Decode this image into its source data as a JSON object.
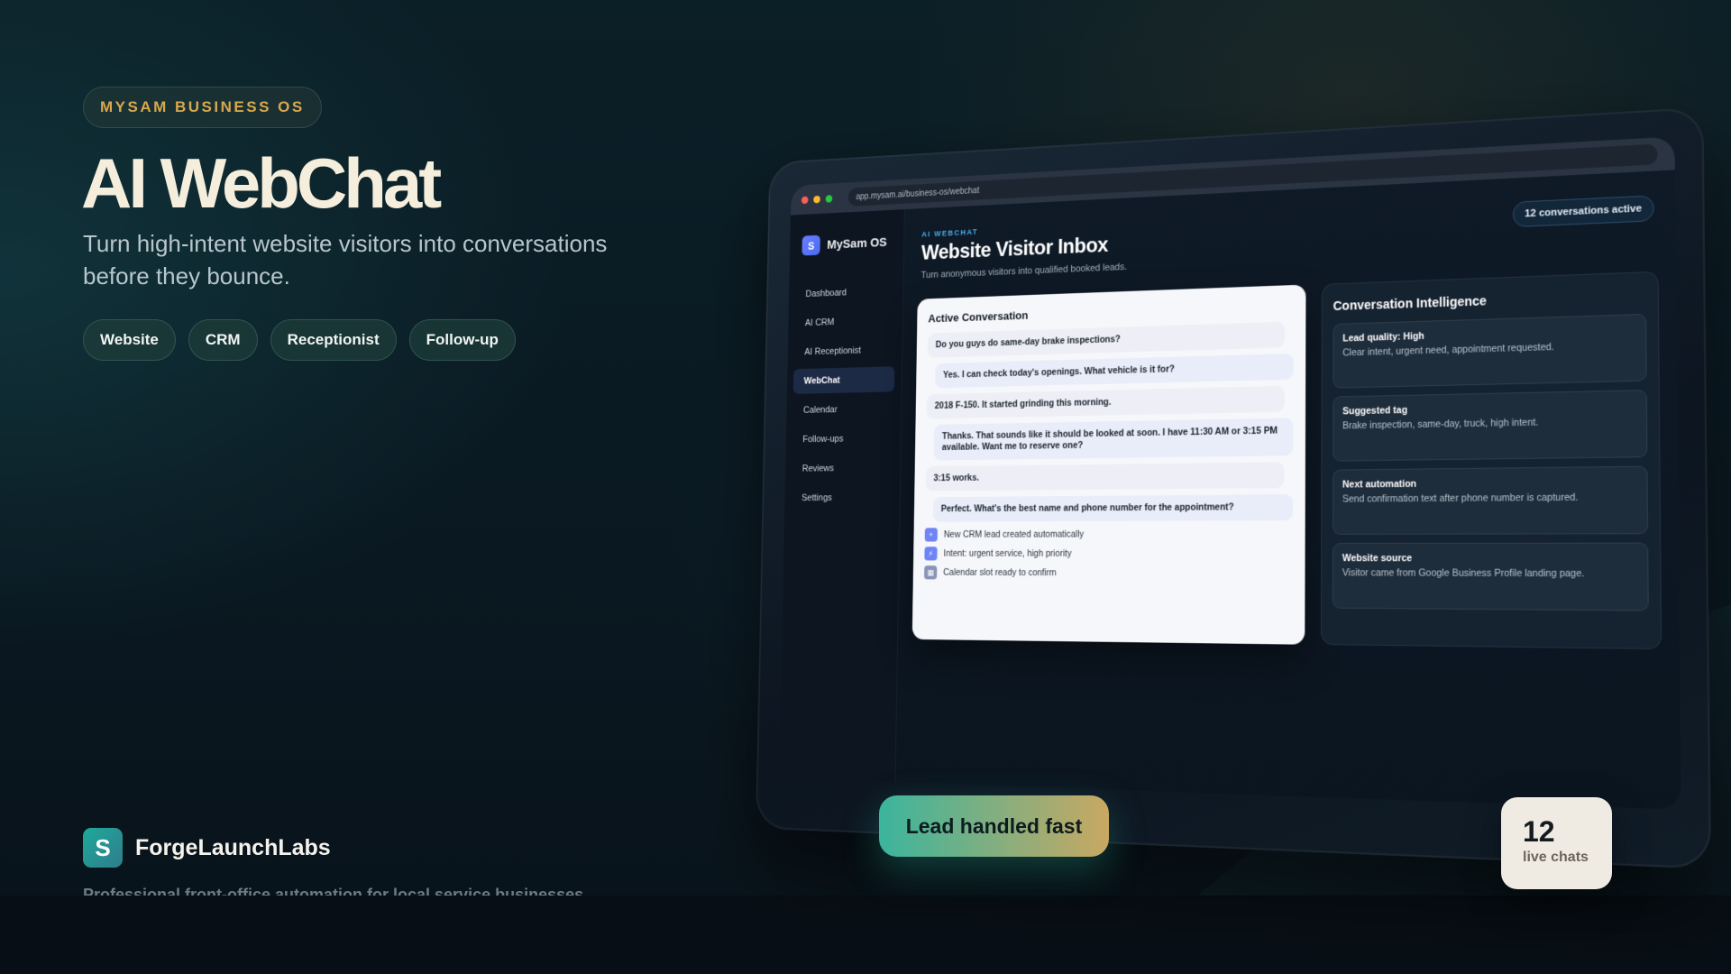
{
  "hero": {
    "badge": "MYSAM BUSINESS OS",
    "title": "AI WebChat",
    "subtitle": "Turn high-intent website visitors into conversations before they bounce.",
    "chips": [
      "Website",
      "CRM",
      "Receptionist",
      "Follow-up"
    ]
  },
  "brand": {
    "logo_letter": "S",
    "name": "ForgeLaunchLabs",
    "tagline": "Professional front-office automation for local service businesses"
  },
  "app": {
    "url": "app.mysam.ai/business-os/webchat",
    "logo_letter": "S",
    "name": "MySam OS",
    "nav": [
      {
        "label": "Dashboard",
        "active": false
      },
      {
        "label": "AI CRM",
        "active": false
      },
      {
        "label": "AI Receptionist",
        "active": false
      },
      {
        "label": "WebChat",
        "active": true
      },
      {
        "label": "Calendar",
        "active": false
      },
      {
        "label": "Follow-ups",
        "active": false
      },
      {
        "label": "Reviews",
        "active": false
      },
      {
        "label": "Settings",
        "active": false
      }
    ],
    "kicker": "AI WEBCHAT",
    "title": "Website Visitor Inbox",
    "subtitle": "Turn anonymous visitors into qualified booked leads.",
    "active_count_label": "12 conversations active"
  },
  "chat": {
    "title": "Active Conversation",
    "messages": [
      {
        "role": "visitor",
        "text": "Do you guys do same-day brake inspections?"
      },
      {
        "role": "agent",
        "text": "Yes. I can check today's openings. What vehicle is it for?"
      },
      {
        "role": "visitor",
        "text": "2018 F-150. It started grinding this morning."
      },
      {
        "role": "agent",
        "text": "Thanks. That sounds like it should be looked at soon. I have 11:30 AM or 3:15 PM available. Want me to reserve one?"
      },
      {
        "role": "visitor",
        "text": "3:15 works."
      },
      {
        "role": "agent",
        "text": "Perfect. What's the best name and phone number for the appointment?"
      }
    ],
    "events": [
      {
        "icon": "plus-icon",
        "text": "New CRM lead created automatically"
      },
      {
        "icon": "lightning-icon",
        "text": "Intent: urgent service, high priority"
      },
      {
        "icon": "calendar-icon",
        "text": "Calendar slot ready to confirm"
      }
    ]
  },
  "intel": {
    "title": "Conversation Intelligence",
    "items": [
      {
        "heading": "Lead quality: High",
        "body": "Clear intent, urgent need, appointment requested."
      },
      {
        "heading": "Suggested tag",
        "body": "Brake inspection, same-day, truck, high intent."
      },
      {
        "heading": "Next automation",
        "body": "Send confirmation text after phone number is captured."
      },
      {
        "heading": "Website source",
        "body": "Visitor came from Google Business Profile landing page."
      }
    ]
  },
  "floating": {
    "lead_label": "Lead handled fast",
    "count": "12",
    "count_label": "live chats"
  },
  "colors": {
    "accent_gold": "#d8a84e",
    "accent_teal": "#1fa99a",
    "app_blue": "#4aa9e8",
    "traffic_red": "#ff5f57",
    "traffic_yellow": "#febc2e",
    "traffic_green": "#28c840"
  }
}
